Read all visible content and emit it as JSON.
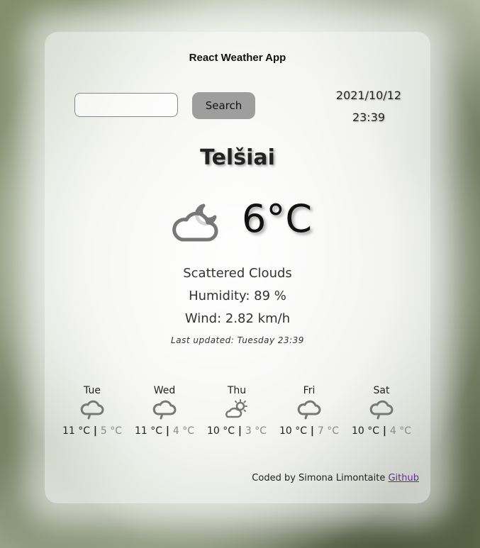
{
  "app": {
    "title": "React Weather App"
  },
  "search": {
    "placeholder": "",
    "value": "",
    "button_label": "Search"
  },
  "datetime": {
    "date": "2021/10/12",
    "time": "23:39"
  },
  "current": {
    "city": "Telšiai",
    "temperature": "6°C",
    "icon": "cloud-moon-icon",
    "description": "Scattered Clouds",
    "humidity": "Humidity: 89 %",
    "wind": "Wind: 2.82 km/h",
    "last_updated": "Last updated: Tuesday 23:39"
  },
  "forecast": [
    {
      "day": "Tue",
      "max": "11 °C",
      "sep": " | ",
      "min": "5 °C",
      "icon": "cloud-icon"
    },
    {
      "day": "Wed",
      "max": "11 °C",
      "sep": " | ",
      "min": "4 °C",
      "icon": "cloud-icon"
    },
    {
      "day": "Thu",
      "max": "10 °C",
      "sep": " | ",
      "min": "3 °C",
      "icon": "cloud-sun-icon"
    },
    {
      "day": "Fri",
      "max": "10 °C",
      "sep": " | ",
      "min": "7 °C",
      "icon": "cloud-icon"
    },
    {
      "day": "Sat",
      "max": "10 °C",
      "sep": " | ",
      "min": "4 °C",
      "icon": "cloud-icon"
    }
  ],
  "footer": {
    "credit": "Coded by Simona Limontaite ",
    "link_label": "Github"
  },
  "colors": {
    "card": "#ffffff",
    "button": "#9e9e9e",
    "link": "#5b2e91",
    "icon": "#777777"
  }
}
